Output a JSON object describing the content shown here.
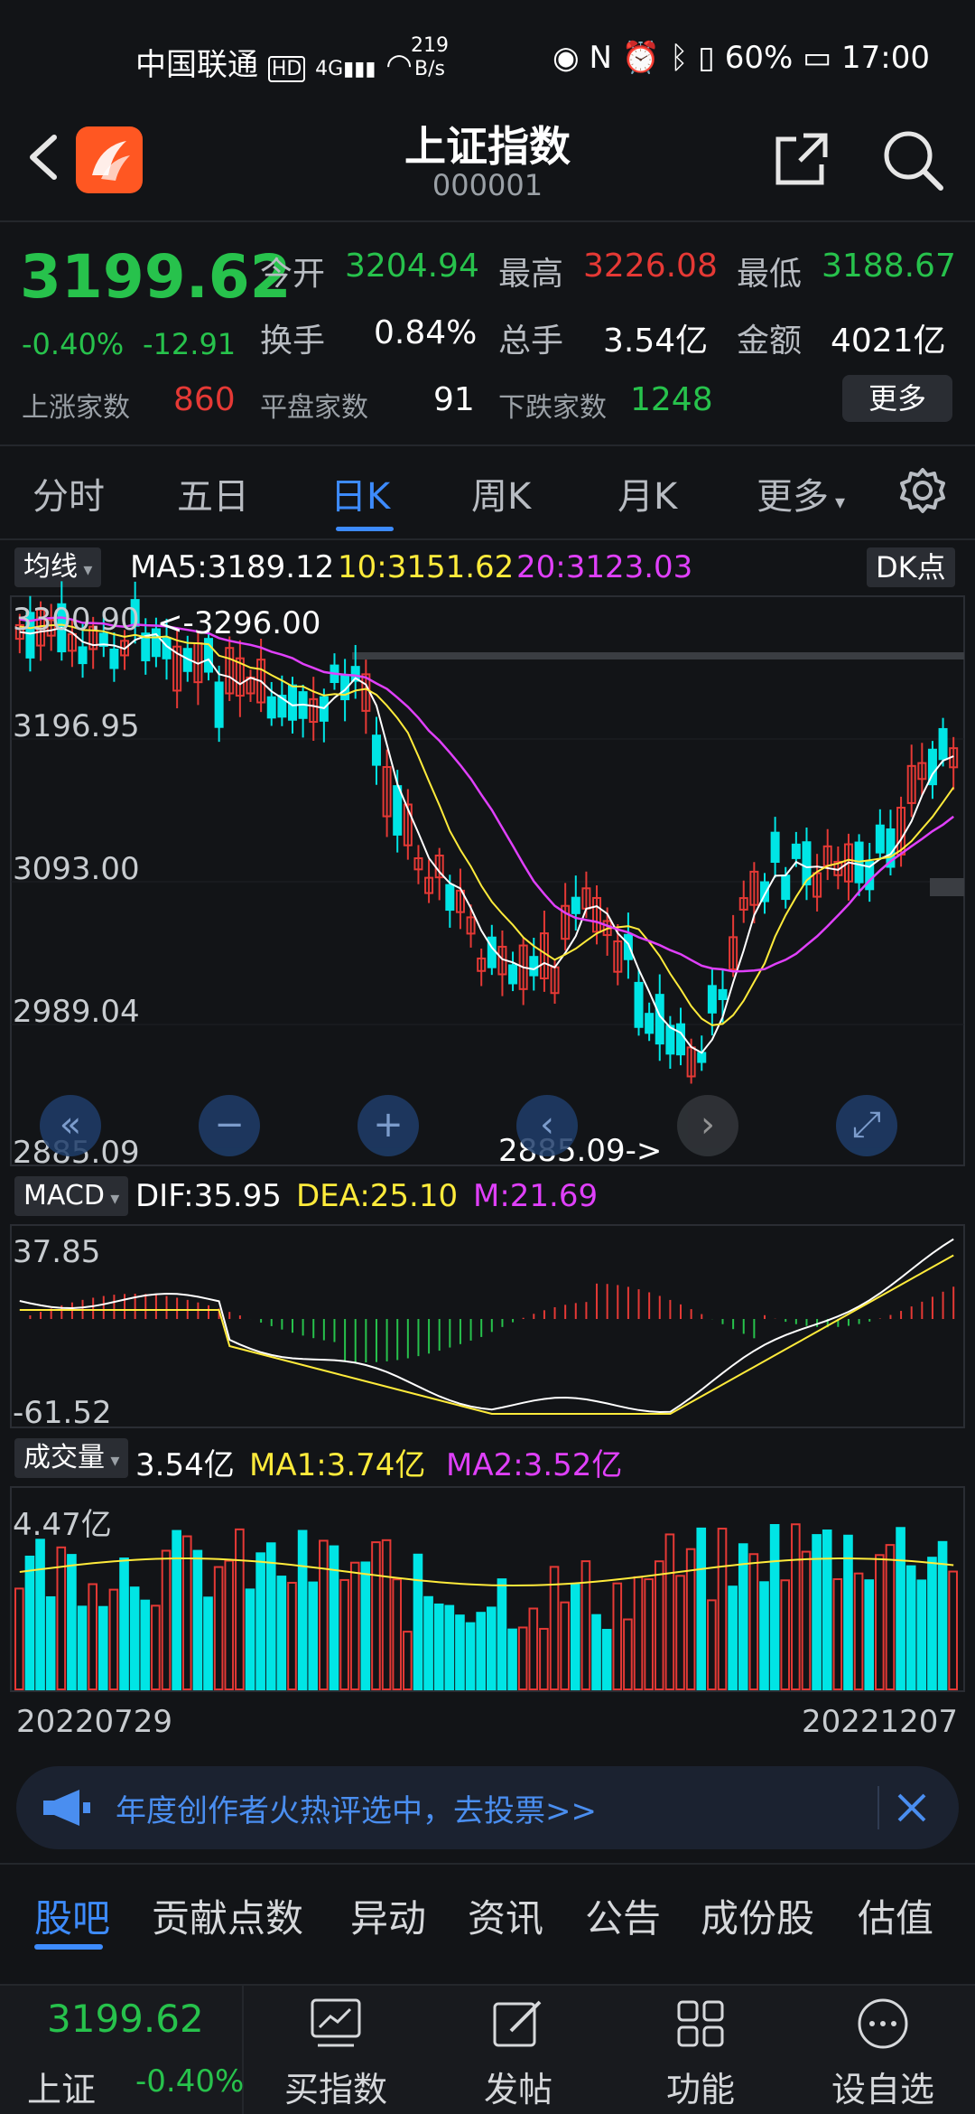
{
  "status_bar": {
    "carrier": "中国联通",
    "network": "HD 4G",
    "speed_value": "219",
    "speed_unit": "B/s",
    "battery": "60%",
    "time": "17:00"
  },
  "header": {
    "title": "上证指数",
    "code": "000001"
  },
  "quote": {
    "price": "3199.62",
    "change_pct": "-0.40%",
    "change_abs": "-12.91",
    "open_label": "今开",
    "open": "3204.94",
    "high_label": "最高",
    "high": "3226.08",
    "low_label": "最低",
    "low": "3188.67",
    "turnover_label": "换手",
    "turnover": "0.84%",
    "volume_label": "总手",
    "volume": "3.54亿",
    "amount_label": "金额",
    "amount": "4021亿",
    "up_label": "上涨家数",
    "up": "860",
    "flat_label": "平盘家数",
    "flat": "91",
    "down_label": "下跌家数",
    "down": "1248",
    "more_button": "更多"
  },
  "period_tabs": [
    "分时",
    "五日",
    "日K",
    "周K",
    "月K",
    "更多"
  ],
  "active_period": "日K",
  "kline_panel": {
    "indicator_select": "均线",
    "ma5": "MA5:3189.12",
    "ma10": "10:3151.62",
    "ma20": "20:3123.03",
    "dk_button": "DK点",
    "y_labels": [
      "3300.90",
      "3196.95",
      "3093.00",
      "2989.04",
      "2885.09"
    ],
    "max_marker": "<-3296.00",
    "min_marker": "2885.09->"
  },
  "macd_panel": {
    "indicator_select": "MACD",
    "dif": "DIF:35.95",
    "dea": "DEA:25.10",
    "m": "M:21.69",
    "y_top": "37.85",
    "y_bottom": "-61.52"
  },
  "volume_panel": {
    "indicator_select": "成交量",
    "vol": "3.54亿",
    "ma1": "MA1:3.74亿",
    "ma2": "MA2:3.52亿",
    "y_top": "4.47亿",
    "date_start": "20220729",
    "date_end": "20221207"
  },
  "banner": {
    "text": "年度创作者火热评选中，去投票>>"
  },
  "bottom_tabs": [
    "股吧",
    "贡献点数",
    "异动",
    "资讯",
    "公告",
    "成份股",
    "估值"
  ],
  "toolbar": {
    "mini_price": "3199.62",
    "mini_name": "上证",
    "mini_change": "-0.40%",
    "buy_index": "买指数",
    "post": "发帖",
    "functions": "功能",
    "watchlist": "设自选"
  },
  "colors": {
    "up": "#e53935",
    "down": "#00e5e5",
    "ma5": "#ffffff",
    "ma10": "#ffeb3b",
    "ma20": "#e040fb",
    "accent": "#3d8bfd"
  }
}
